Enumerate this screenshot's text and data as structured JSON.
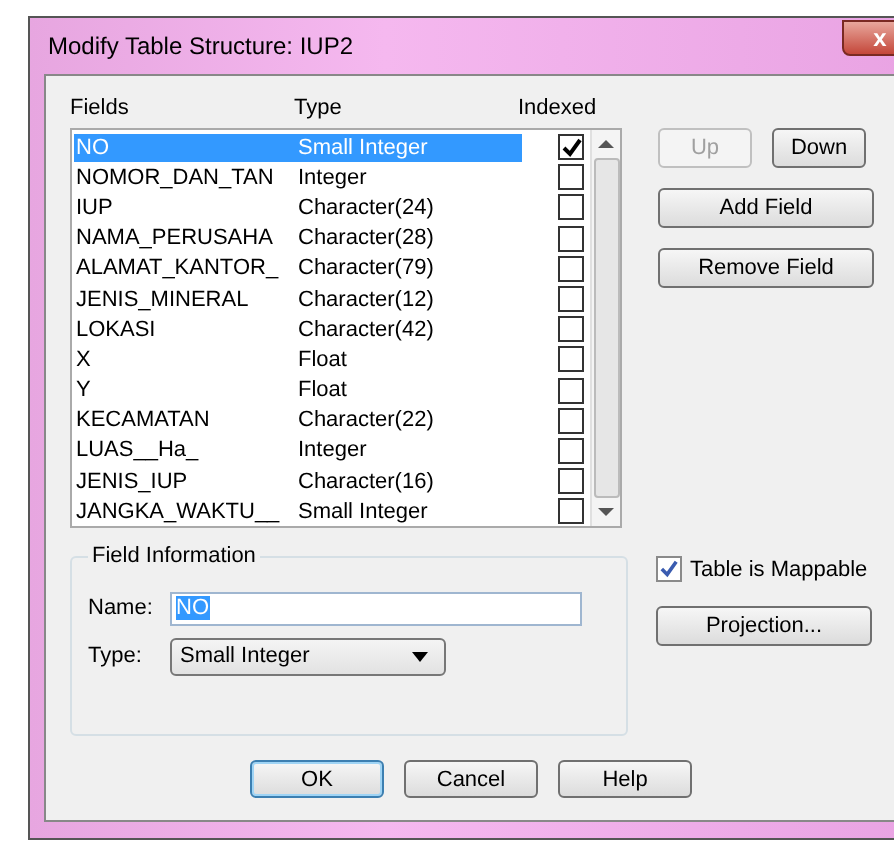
{
  "window": {
    "title": "Modify Table Structure: IUP2",
    "close": "x"
  },
  "columns": [
    "Fields",
    "Type",
    "Indexed"
  ],
  "fields": [
    {
      "name": "NO",
      "type": "Small Integer",
      "indexed": true,
      "selected": true
    },
    {
      "name": "NOMOR_DAN_TAN",
      "type": "Integer",
      "indexed": false,
      "selected": false
    },
    {
      "name": "IUP",
      "type": "Character(24)",
      "indexed": false,
      "selected": false
    },
    {
      "name": "NAMA_PERUSAHA",
      "type": "Character(28)",
      "indexed": false,
      "selected": false
    },
    {
      "name": "ALAMAT_KANTOR_",
      "type": "Character(79)",
      "indexed": false,
      "selected": false
    },
    {
      "name": "JENIS_MINERAL",
      "type": "Character(12)",
      "indexed": false,
      "selected": false
    },
    {
      "name": "LOKASI",
      "type": "Character(42)",
      "indexed": false,
      "selected": false
    },
    {
      "name": "X",
      "type": "Float",
      "indexed": false,
      "selected": false
    },
    {
      "name": "Y",
      "type": "Float",
      "indexed": false,
      "selected": false
    },
    {
      "name": "KECAMATAN",
      "type": "Character(22)",
      "indexed": false,
      "selected": false
    },
    {
      "name": "LUAS__Ha_",
      "type": "Integer",
      "indexed": false,
      "selected": false
    },
    {
      "name": "JENIS_IUP",
      "type": "Character(16)",
      "indexed": false,
      "selected": false
    },
    {
      "name": "JANGKA_WAKTU__",
      "type": "Small Integer",
      "indexed": false,
      "selected": false
    }
  ],
  "side_buttons": [
    {
      "label": "Up",
      "disabled": true
    },
    {
      "label": "Down",
      "disabled": false
    },
    {
      "label": "Add Field",
      "disabled": false
    },
    {
      "label": "Remove Field",
      "disabled": false
    }
  ],
  "field_information": {
    "title": "Field Information",
    "name_label": "Name:",
    "name_value": "NO",
    "type_label": "Type:",
    "type_value": "Small Integer"
  },
  "mappable": {
    "label": "Table is Mappable",
    "checked": true
  },
  "projection_button": "Projection...",
  "buttons": [
    {
      "label": "OK",
      "default": true
    },
    {
      "label": "Cancel",
      "default": false
    },
    {
      "label": "Help",
      "default": false
    }
  ]
}
